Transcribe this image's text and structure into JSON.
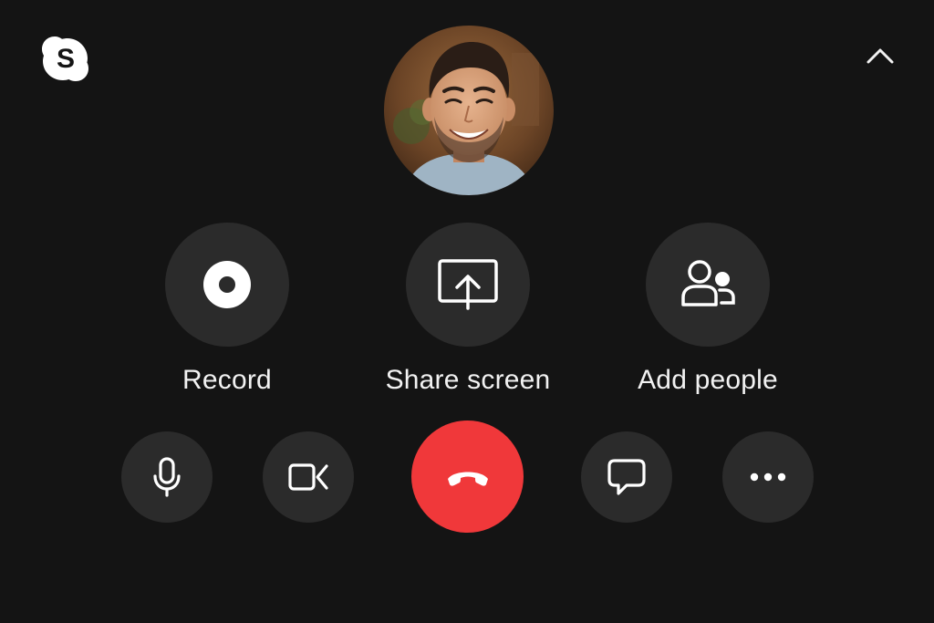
{
  "app": {
    "logo_icon": "skype-logo-icon",
    "collapse_icon": "chevron-up-icon"
  },
  "participant": {
    "avatar_icon": "participant-avatar-photo"
  },
  "actions": {
    "record": {
      "label": "Record",
      "icon": "record-icon"
    },
    "share_screen": {
      "label": "Share screen",
      "icon": "share-screen-icon"
    },
    "add_people": {
      "label": "Add people",
      "icon": "add-people-icon"
    }
  },
  "controls": {
    "mic_icon": "microphone-icon",
    "camera_icon": "video-camera-off-icon",
    "hangup_icon": "end-call-icon",
    "chat_icon": "chat-icon",
    "more_icon": "more-options-icon"
  },
  "colors": {
    "background": "#141414",
    "button": "#2b2b2b",
    "hangup": "#f0383a",
    "text": "#f2f2f2"
  }
}
